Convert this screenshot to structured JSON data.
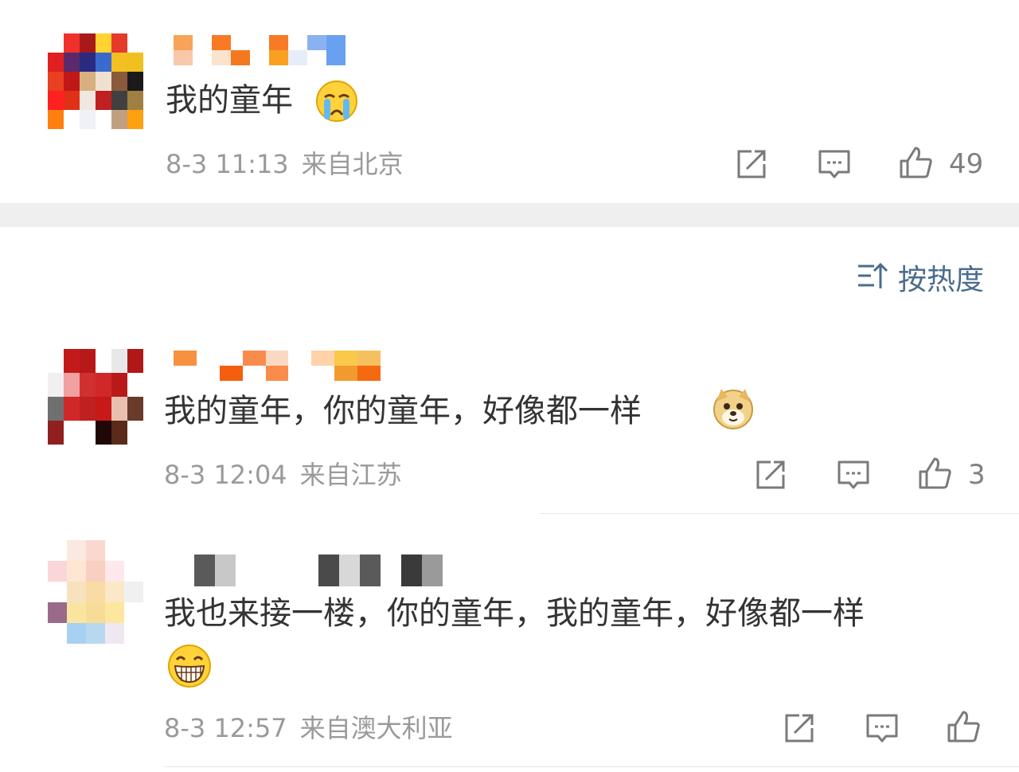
{
  "sort": {
    "label": "按热度",
    "icon": "sort-icon"
  },
  "comments": [
    {
      "text": "我的童年",
      "emoji": "crying-face-emoji",
      "time": "8-3 11:13",
      "location": "来自北京",
      "likes": "49",
      "avatar_colors": [
        "#ffffff",
        "#f0302a",
        "#a81a1a",
        "#ffd330",
        "#e63a2a",
        "#ffffff",
        "#e02020",
        "#5a2a6a",
        "#2a2a80",
        "#3a6ad0",
        "#f2c020",
        "#f0c020",
        "#e84020",
        "#c01818",
        "#d8b080",
        "#f0e0d0",
        "#8a5a3a",
        "#1a1a1a",
        "#ff2020",
        "#e03018",
        "#f0e8e0",
        "#c02020",
        "#404040",
        "#a08040",
        "#ff8010",
        "#ffffff",
        "#f0f0f8",
        "#ffffff",
        "#c0a080",
        "#ffa010"
      ],
      "name_colors": [
        "#f7a35a",
        "#ffffff",
        "#f87a25",
        "#ffffff",
        "#ffffff",
        "#f87a25",
        "#ffffff",
        "#8ab2f0",
        "#6aa0f0",
        "#ffffff",
        "#f9c7a9",
        "#ffffff",
        "#fde3cc",
        "#f47820",
        "#ffffff",
        "#f9a020",
        "#e6ecf9",
        "#ffffff",
        "#6aa0f0"
      ]
    },
    {
      "text": "我的童年，你的童年，好像都一样",
      "emoji": "doge-emoji",
      "time": "8-3 12:04",
      "location": "来自江苏",
      "likes": "3",
      "avatar_colors": [
        "#ffffff",
        "#c21a1a",
        "#b81818",
        "#ffffff",
        "#e8e8e8",
        "#b01818",
        "#f0f0f0",
        "#f0a0a0",
        "#d03030",
        "#d02828",
        "#b81a1a",
        "#ffffff",
        "#707070",
        "#d02828",
        "#c02020",
        "#c81818",
        "#e8c0b0",
        "#6a3a2a",
        "#902020",
        "#ffffff",
        "#ffffff",
        "#200808",
        "#5a2a1a",
        "#ffffff"
      ],
      "name_colors": [
        "#f79040",
        "#ffffff",
        "#ffffff",
        "#f98c4d",
        "#fad9c3",
        "#ffffff",
        "#ffd2a9",
        "#f9c94a",
        "#f6c060",
        "#ffffff",
        "#ffffff",
        "#f45e10",
        "#ffffff",
        "#f98c4d",
        "#ffffff",
        "#ffffff",
        "#f29a30",
        "#f46a10"
      ]
    },
    {
      "text_line1": "我也来接一楼，你的童年，我的童年，好像都一样",
      "emoji": "grinning-face-emoji",
      "time": "8-3 12:57",
      "location": "来自澳大利亚",
      "avatar_colors": [
        "#ffffff",
        "#fbe8e0",
        "#f9d8d0",
        "#ffffff",
        "#ffffff",
        "#fbd6d8",
        "#ffe6d2",
        "#f8cfc0",
        "#ffe8ec",
        "#ffffff",
        "#ffffff",
        "#f7e2c0",
        "#f9dca4",
        "#fbe8c8",
        "#f0f0f0",
        "#9a6a8a",
        "#f9e5a0",
        "#f7dc98",
        "#fde6a0",
        "#ffffff",
        "#ffffff",
        "#a8d0f0",
        "#b8d8f0",
        "#f0e8f0",
        "#ffffff"
      ],
      "name_colors": [
        "#ffffff",
        "#5a5a5a",
        "#c8c8c8",
        "#ffffff",
        "#ffffff",
        "#ffffff",
        "#ffffff",
        "#4a4a4a",
        "#d8d8d8",
        "#5a5a5a",
        "#ffffff",
        "#3a3a3a",
        "#9a9a9a"
      ]
    }
  ]
}
